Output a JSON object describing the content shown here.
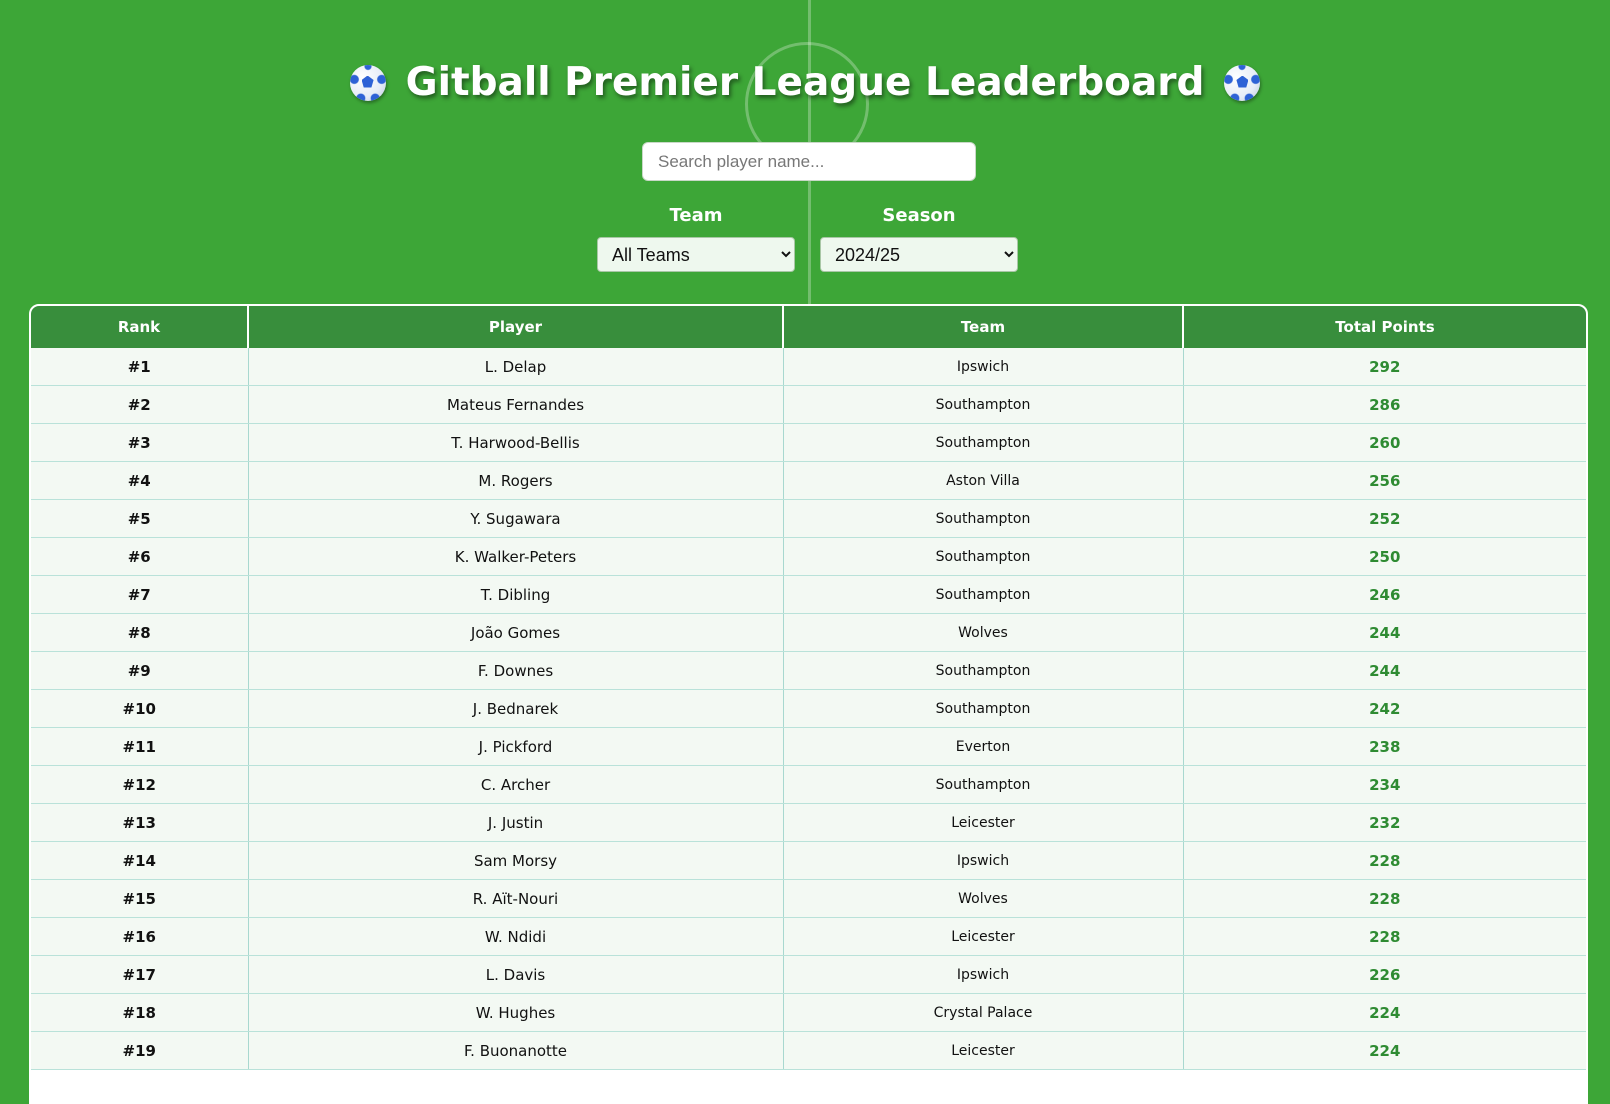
{
  "header": {
    "title": "Gitball Premier League Leaderboard"
  },
  "search": {
    "placeholder": "Search player name..."
  },
  "filters": {
    "team": {
      "label": "Team",
      "selected": "All Teams"
    },
    "season": {
      "label": "Season",
      "selected": "2024/25"
    }
  },
  "table": {
    "columns": [
      "Rank",
      "Player",
      "Team",
      "Total Points"
    ],
    "rows": [
      {
        "rank": "#1",
        "player": "L. Delap",
        "team": "Ipswich",
        "points": "292"
      },
      {
        "rank": "#2",
        "player": "Mateus Fernandes",
        "team": "Southampton",
        "points": "286"
      },
      {
        "rank": "#3",
        "player": "T. Harwood-Bellis",
        "team": "Southampton",
        "points": "260"
      },
      {
        "rank": "#4",
        "player": "M. Rogers",
        "team": "Aston Villa",
        "points": "256"
      },
      {
        "rank": "#5",
        "player": "Y. Sugawara",
        "team": "Southampton",
        "points": "252"
      },
      {
        "rank": "#6",
        "player": "K. Walker-Peters",
        "team": "Southampton",
        "points": "250"
      },
      {
        "rank": "#7",
        "player": "T. Dibling",
        "team": "Southampton",
        "points": "246"
      },
      {
        "rank": "#8",
        "player": "João Gomes",
        "team": "Wolves",
        "points": "244"
      },
      {
        "rank": "#9",
        "player": "F. Downes",
        "team": "Southampton",
        "points": "244"
      },
      {
        "rank": "#10",
        "player": "J. Bednarek",
        "team": "Southampton",
        "points": "242"
      },
      {
        "rank": "#11",
        "player": "J. Pickford",
        "team": "Everton",
        "points": "238"
      },
      {
        "rank": "#12",
        "player": "C. Archer",
        "team": "Southampton",
        "points": "234"
      },
      {
        "rank": "#13",
        "player": "J. Justin",
        "team": "Leicester",
        "points": "232"
      },
      {
        "rank": "#14",
        "player": "Sam Morsy",
        "team": "Ipswich",
        "points": "228"
      },
      {
        "rank": "#15",
        "player": "R. Aït-Nouri",
        "team": "Wolves",
        "points": "228"
      },
      {
        "rank": "#16",
        "player": "W. Ndidi",
        "team": "Leicester",
        "points": "228"
      },
      {
        "rank": "#17",
        "player": "L. Davis",
        "team": "Ipswich",
        "points": "226"
      },
      {
        "rank": "#18",
        "player": "W. Hughes",
        "team": "Crystal Palace",
        "points": "224"
      },
      {
        "rank": "#19",
        "player": "F. Buonanotte",
        "team": "Leicester",
        "points": "224"
      }
    ]
  }
}
